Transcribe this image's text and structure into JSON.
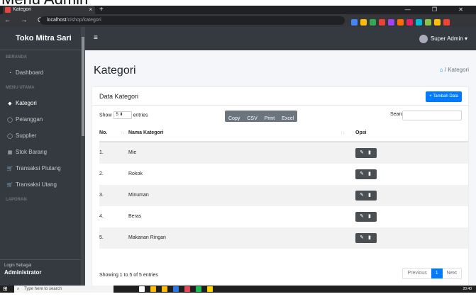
{
  "page_top_text": "Menu Admin",
  "browser": {
    "tab_title": "Kategori",
    "tab_close": "×",
    "new_tab": "+",
    "window_controls": "— ❐ ✕",
    "nav_glyphs": "← → C",
    "url_host": "localhost",
    "url_path": "/cishop/kategori",
    "extension_colors": [
      "#4285f4",
      "#fbbc05",
      "#34a853",
      "#ea4335",
      "#a142f4",
      "#ff6d00",
      "#e91e63",
      "#00bcd4",
      "#8bc34a",
      "#ffc107",
      "#f44336"
    ]
  },
  "sidebar": {
    "brand": "Toko Mitra Sari",
    "headers": {
      "beranda": "BERANDA",
      "menu_utama": "MENU UTAMA",
      "laporan": "LAPORAN"
    },
    "items": [
      {
        "label": "Dashboard",
        "icon": "dashboard-icon",
        "glyph": "◔"
      },
      {
        "label": "Kategori",
        "icon": "tag-icon",
        "glyph": "◆",
        "active": true
      },
      {
        "label": "Pelanggan",
        "icon": "user-circle-icon",
        "glyph": "◯"
      },
      {
        "label": "Supplier",
        "icon": "user-circle-icon",
        "glyph": "◯"
      },
      {
        "label": "Stok Barang",
        "icon": "boxes-icon",
        "glyph": "▦"
      },
      {
        "label": "Transaksi Piutang",
        "icon": "cart-icon",
        "glyph": "🛒"
      },
      {
        "label": "Transaksi Utang",
        "icon": "cart-icon",
        "glyph": "🛒"
      }
    ],
    "login_label": "Login Sebagai",
    "login_role": "Administrator"
  },
  "topnav": {
    "menu_glyph": "≡",
    "user_name": "Super Admin ▾"
  },
  "page": {
    "title": "Kategori",
    "breadcrumb_current": "/ Kategori",
    "card_title": "Data Kategori",
    "add_button": "+ Tambah Data",
    "show_label": "Show",
    "entries_label": "entries",
    "page_size": "5 ⬍",
    "export_buttons": [
      "Copy",
      "CSV",
      "Print",
      "Excel"
    ],
    "search_label": "Search:",
    "columns": [
      "No.",
      "Nama Kategori",
      "Opsi"
    ],
    "rows": [
      {
        "no": "1.",
        "name": "Mie"
      },
      {
        "no": "2.",
        "name": "Rokok"
      },
      {
        "no": "3.",
        "name": "Minuman"
      },
      {
        "no": "4.",
        "name": "Beras"
      },
      {
        "no": "5.",
        "name": "Makanan Ringan"
      }
    ],
    "action_glyph": "✎ ▮",
    "info": "Showing 1 to 5 of 5 entries",
    "pager": {
      "prev": "Previous",
      "current": "1",
      "next": "Next"
    }
  },
  "taskbar": {
    "search_placeholder": "Type here to search",
    "clock": "20:40",
    "app_colors": [
      "#ffffff",
      "#ffb900",
      "#ffb900",
      "#2b78e4",
      "#e74856",
      "#1db954",
      "#ffd700"
    ]
  }
}
